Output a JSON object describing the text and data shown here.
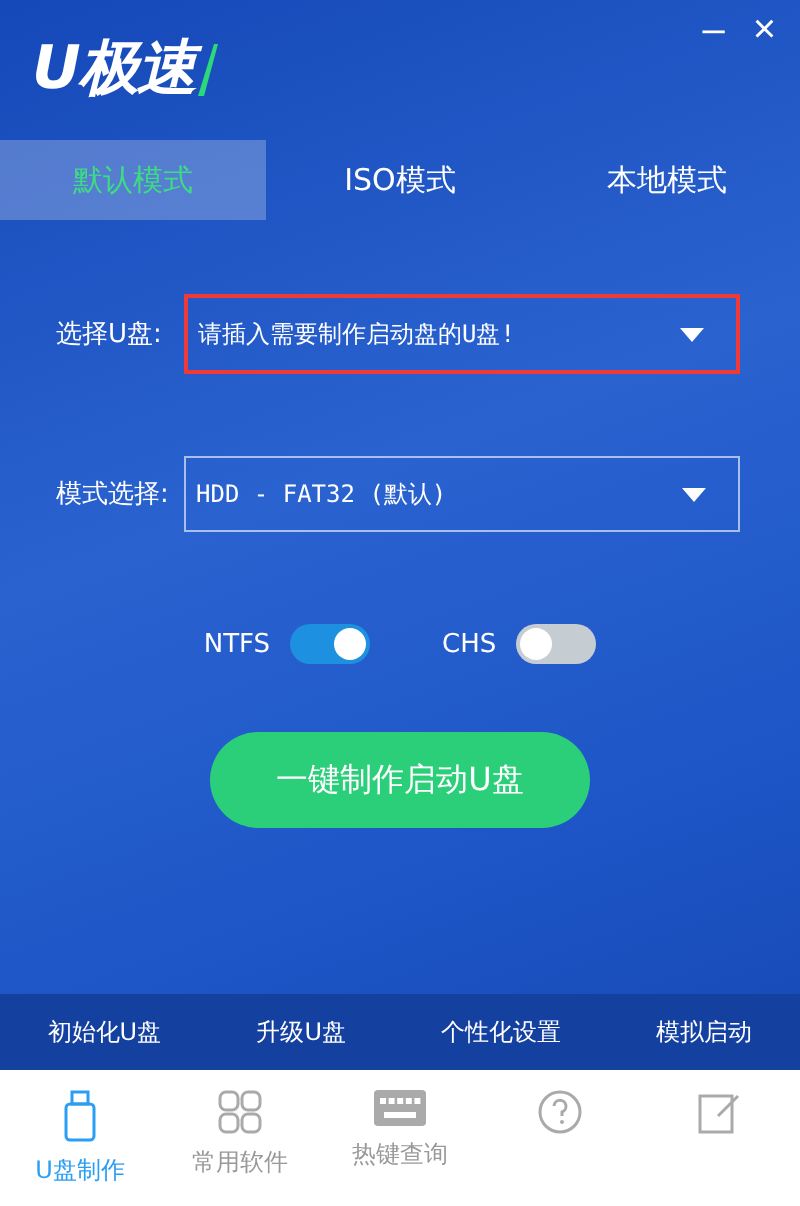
{
  "logo": {
    "text": "U极速"
  },
  "window_controls": [
    "–",
    "×"
  ],
  "tabs": [
    {
      "label": "默认模式",
      "selected": true
    },
    {
      "label": "ISO模式",
      "selected": false
    },
    {
      "label": "本地模式",
      "selected": false
    }
  ],
  "fields": [
    {
      "label": "选择U盘:",
      "value": "请插入需要制作启动盘的U盘!",
      "highlighted": true
    },
    {
      "label": "模式选择:",
      "value": "HDD - FAT32 (默认)",
      "highlighted": false
    }
  ],
  "toggles": [
    {
      "label": "NTFS",
      "on": true
    },
    {
      "label": "CHS",
      "on": false
    }
  ],
  "primary_button": "一键制作启动U盘",
  "tools": [
    "初始化U盘",
    "升级U盘",
    "个性化设置",
    "模拟启动"
  ],
  "nav": [
    {
      "kind": "usb",
      "label": "U盘制作",
      "selected": true
    },
    {
      "kind": "grid",
      "label": "常用软件",
      "selected": false
    },
    {
      "kind": "keyboard",
      "label": "热键查询",
      "selected": false
    },
    {
      "kind": "help",
      "selected": false
    },
    {
      "kind": "edit",
      "selected": false
    }
  ]
}
